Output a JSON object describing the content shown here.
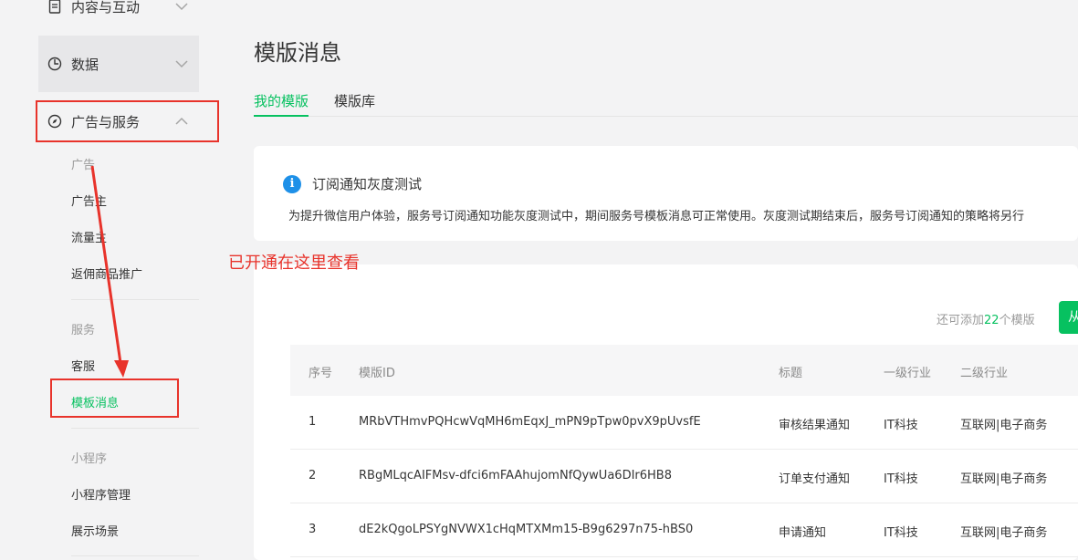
{
  "sidebar": {
    "content_interaction": "内容与互动",
    "data": "数据",
    "ads_services": "广告与服务",
    "ads_group": "广告",
    "advertiser": "广告主",
    "publisher": "流量主",
    "rebate_promo": "返佣商品推广",
    "services_group": "服务",
    "customer_service": "客服",
    "template_message": "模板消息",
    "miniprogram_group": "小程序",
    "miniprogram_mgmt": "小程序管理",
    "display_scene": "展示场景"
  },
  "page": {
    "title": "模版消息",
    "tabs": [
      "我的模版",
      "模版库"
    ]
  },
  "notice": {
    "title": "订阅通知灰度测试",
    "description": "为提升微信用户体验，服务号订阅通知功能灰度测试中，期间服务号模板消息可正常使用。灰度测试期结束后，服务号订阅通知的策略将另行"
  },
  "quota": {
    "prefix": "还可添加",
    "count": "22",
    "suffix": "个模版"
  },
  "add_button": "从",
  "table": {
    "headers": [
      "序号",
      "模版ID",
      "标题",
      "一级行业",
      "二级行业"
    ],
    "rows": [
      [
        "1",
        "MRbVTHmvPQHcwVqMH6mEqxJ_mPN9pTpw0pvX9pUvsfE",
        "审核结果通知",
        "IT科技",
        "互联网|电子商务"
      ],
      [
        "2",
        "RBgMLqcAIFMsv-dfci6mFAAhujomNfQywUa6DIr6HB8",
        "订单支付通知",
        "IT科技",
        "互联网|电子商务"
      ],
      [
        "3",
        "dE2kQgoLPSYgNVWX1cHqMTXMm15-B9g6297n75-hBS0",
        "申请通知",
        "IT科技",
        "互联网|电子商务"
      ]
    ]
  },
  "annotation": {
    "text": "已开通在这里查看",
    "color": "#e8332b"
  },
  "colors": {
    "accent": "#07c160",
    "info": "#1e90e8"
  },
  "icons": [
    "document-icon",
    "pie-chart-icon",
    "compass-icon",
    "chevron-down-icon",
    "chevron-up-icon",
    "info-icon"
  ]
}
